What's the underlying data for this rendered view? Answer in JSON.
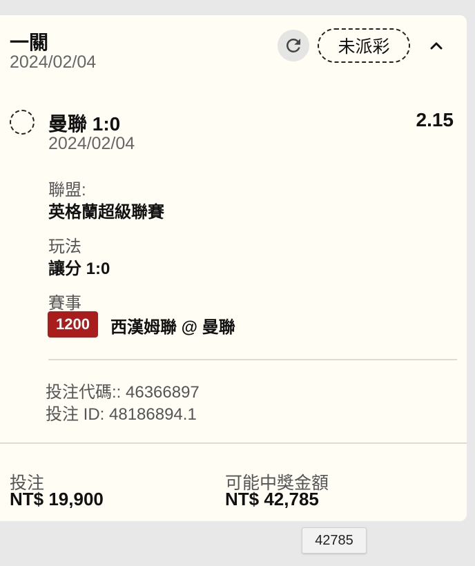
{
  "bet": {
    "title": "一關",
    "date": "2024/02/04",
    "status": "未派彩",
    "icons": {
      "refresh": "refresh-icon",
      "collapse": "chevron-up-icon",
      "status": "dashed-circle-icon"
    }
  },
  "selection": {
    "name": "曼聯 1:0",
    "odds": "2.15",
    "date": "2024/02/04",
    "league_label": "聯盟:",
    "league": "英格蘭超級聯賽",
    "market_label": "玩法",
    "market": "讓分 1:0",
    "event_label": "賽事",
    "event_id": "1200",
    "event_name": "西漢姆聯 @ 曼聯",
    "bet_code": "投注代碼:: 46366897",
    "bet_id": "投注 ID: 48186894.1"
  },
  "summary": {
    "stake_label": "投注",
    "stake_value": "NT$ 19,900",
    "payout_label": "可能中獎金額",
    "payout_value": "NT$ 42,785"
  },
  "tooltip": {
    "text": "42785"
  },
  "colors": {
    "event_badge": "#a91e1c",
    "card_bg": "#fffdf4",
    "page_bg": "#e8e8e8"
  }
}
